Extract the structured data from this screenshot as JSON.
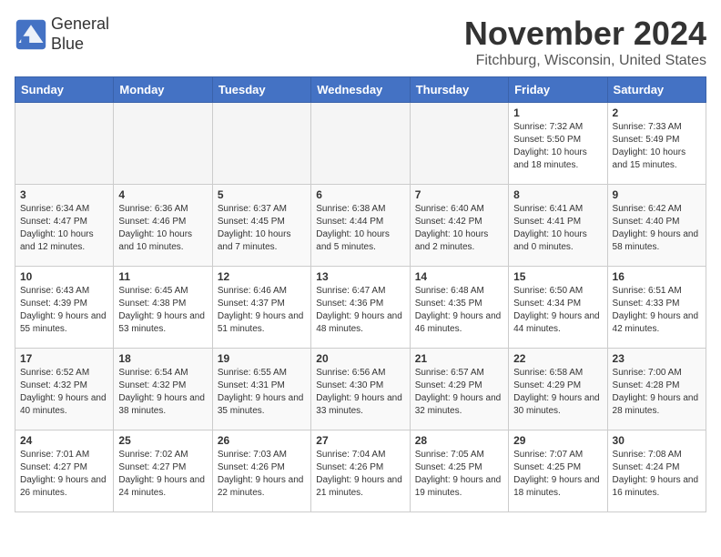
{
  "header": {
    "logo_line1": "General",
    "logo_line2": "Blue",
    "month": "November 2024",
    "location": "Fitchburg, Wisconsin, United States"
  },
  "weekdays": [
    "Sunday",
    "Monday",
    "Tuesday",
    "Wednesday",
    "Thursday",
    "Friday",
    "Saturday"
  ],
  "weeks": [
    [
      {
        "day": "",
        "info": ""
      },
      {
        "day": "",
        "info": ""
      },
      {
        "day": "",
        "info": ""
      },
      {
        "day": "",
        "info": ""
      },
      {
        "day": "",
        "info": ""
      },
      {
        "day": "1",
        "info": "Sunrise: 7:32 AM\nSunset: 5:50 PM\nDaylight: 10 hours and 18 minutes."
      },
      {
        "day": "2",
        "info": "Sunrise: 7:33 AM\nSunset: 5:49 PM\nDaylight: 10 hours and 15 minutes."
      }
    ],
    [
      {
        "day": "3",
        "info": "Sunrise: 6:34 AM\nSunset: 4:47 PM\nDaylight: 10 hours and 12 minutes."
      },
      {
        "day": "4",
        "info": "Sunrise: 6:36 AM\nSunset: 4:46 PM\nDaylight: 10 hours and 10 minutes."
      },
      {
        "day": "5",
        "info": "Sunrise: 6:37 AM\nSunset: 4:45 PM\nDaylight: 10 hours and 7 minutes."
      },
      {
        "day": "6",
        "info": "Sunrise: 6:38 AM\nSunset: 4:44 PM\nDaylight: 10 hours and 5 minutes."
      },
      {
        "day": "7",
        "info": "Sunrise: 6:40 AM\nSunset: 4:42 PM\nDaylight: 10 hours and 2 minutes."
      },
      {
        "day": "8",
        "info": "Sunrise: 6:41 AM\nSunset: 4:41 PM\nDaylight: 10 hours and 0 minutes."
      },
      {
        "day": "9",
        "info": "Sunrise: 6:42 AM\nSunset: 4:40 PM\nDaylight: 9 hours and 58 minutes."
      }
    ],
    [
      {
        "day": "10",
        "info": "Sunrise: 6:43 AM\nSunset: 4:39 PM\nDaylight: 9 hours and 55 minutes."
      },
      {
        "day": "11",
        "info": "Sunrise: 6:45 AM\nSunset: 4:38 PM\nDaylight: 9 hours and 53 minutes."
      },
      {
        "day": "12",
        "info": "Sunrise: 6:46 AM\nSunset: 4:37 PM\nDaylight: 9 hours and 51 minutes."
      },
      {
        "day": "13",
        "info": "Sunrise: 6:47 AM\nSunset: 4:36 PM\nDaylight: 9 hours and 48 minutes."
      },
      {
        "day": "14",
        "info": "Sunrise: 6:48 AM\nSunset: 4:35 PM\nDaylight: 9 hours and 46 minutes."
      },
      {
        "day": "15",
        "info": "Sunrise: 6:50 AM\nSunset: 4:34 PM\nDaylight: 9 hours and 44 minutes."
      },
      {
        "day": "16",
        "info": "Sunrise: 6:51 AM\nSunset: 4:33 PM\nDaylight: 9 hours and 42 minutes."
      }
    ],
    [
      {
        "day": "17",
        "info": "Sunrise: 6:52 AM\nSunset: 4:32 PM\nDaylight: 9 hours and 40 minutes."
      },
      {
        "day": "18",
        "info": "Sunrise: 6:54 AM\nSunset: 4:32 PM\nDaylight: 9 hours and 38 minutes."
      },
      {
        "day": "19",
        "info": "Sunrise: 6:55 AM\nSunset: 4:31 PM\nDaylight: 9 hours and 35 minutes."
      },
      {
        "day": "20",
        "info": "Sunrise: 6:56 AM\nSunset: 4:30 PM\nDaylight: 9 hours and 33 minutes."
      },
      {
        "day": "21",
        "info": "Sunrise: 6:57 AM\nSunset: 4:29 PM\nDaylight: 9 hours and 32 minutes."
      },
      {
        "day": "22",
        "info": "Sunrise: 6:58 AM\nSunset: 4:29 PM\nDaylight: 9 hours and 30 minutes."
      },
      {
        "day": "23",
        "info": "Sunrise: 7:00 AM\nSunset: 4:28 PM\nDaylight: 9 hours and 28 minutes."
      }
    ],
    [
      {
        "day": "24",
        "info": "Sunrise: 7:01 AM\nSunset: 4:27 PM\nDaylight: 9 hours and 26 minutes."
      },
      {
        "day": "25",
        "info": "Sunrise: 7:02 AM\nSunset: 4:27 PM\nDaylight: 9 hours and 24 minutes."
      },
      {
        "day": "26",
        "info": "Sunrise: 7:03 AM\nSunset: 4:26 PM\nDaylight: 9 hours and 22 minutes."
      },
      {
        "day": "27",
        "info": "Sunrise: 7:04 AM\nSunset: 4:26 PM\nDaylight: 9 hours and 21 minutes."
      },
      {
        "day": "28",
        "info": "Sunrise: 7:05 AM\nSunset: 4:25 PM\nDaylight: 9 hours and 19 minutes."
      },
      {
        "day": "29",
        "info": "Sunrise: 7:07 AM\nSunset: 4:25 PM\nDaylight: 9 hours and 18 minutes."
      },
      {
        "day": "30",
        "info": "Sunrise: 7:08 AM\nSunset: 4:24 PM\nDaylight: 9 hours and 16 minutes."
      }
    ]
  ]
}
